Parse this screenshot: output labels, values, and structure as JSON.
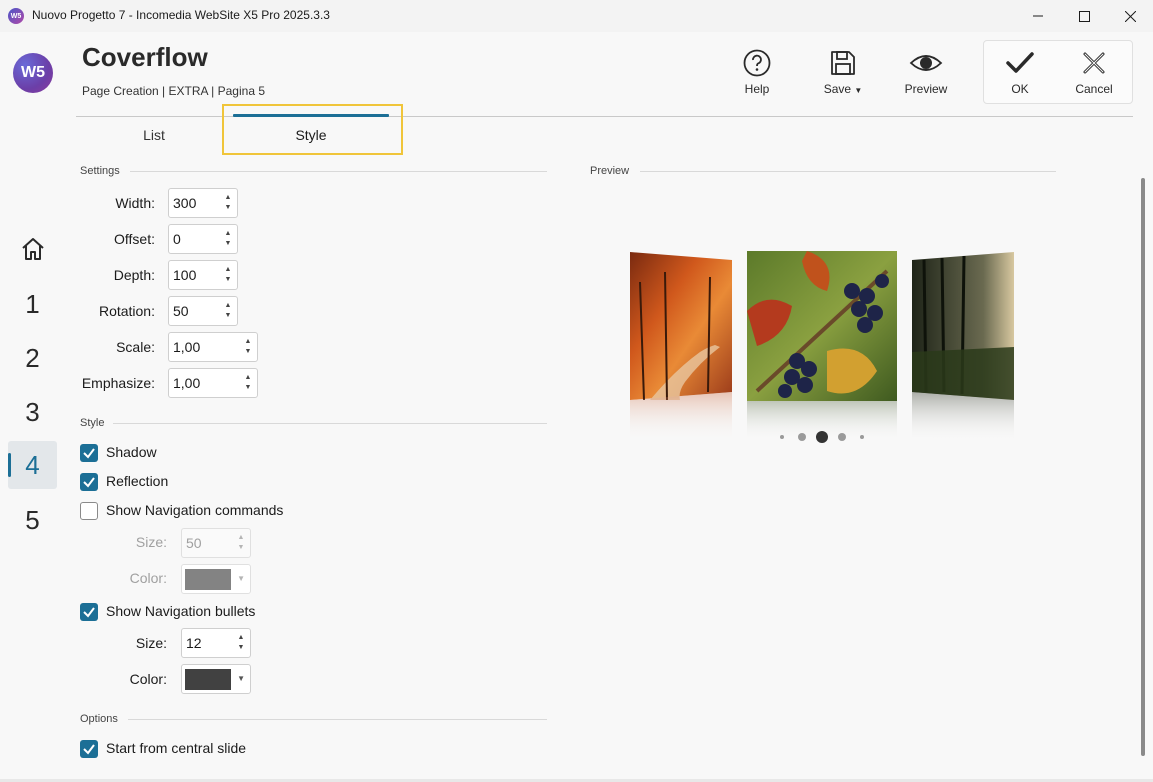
{
  "window": {
    "app_icon_text": "W5",
    "title": "Nuovo Progetto 7 - Incomedia WebSite X5 Pro 2025.3.3"
  },
  "nav": {
    "logo_text": "W5",
    "steps": [
      "1",
      "2",
      "3",
      "4",
      "5"
    ],
    "active_step": "4"
  },
  "header": {
    "title": "Coverflow",
    "breadcrumb": "Page Creation | EXTRA | Pagina 5"
  },
  "toolbar": {
    "help_label": "Help",
    "save_label": "Save",
    "preview_label": "Preview",
    "ok_label": "OK",
    "cancel_label": "Cancel"
  },
  "tabs": {
    "list_label": "List",
    "style_label": "Style",
    "active": "Style"
  },
  "settings": {
    "section_label": "Settings",
    "width_label": "Width:",
    "width_value": "300",
    "offset_label": "Offset:",
    "offset_value": "0",
    "depth_label": "Depth:",
    "depth_value": "100",
    "rotation_label": "Rotation:",
    "rotation_value": "50",
    "scale_label": "Scale:",
    "scale_value": "1,00",
    "emphasize_label": "Emphasize:",
    "emphasize_value": "1,00"
  },
  "style": {
    "section_label": "Style",
    "shadow_label": "Shadow",
    "shadow_checked": true,
    "reflection_label": "Reflection",
    "reflection_checked": true,
    "nav_commands_label": "Show Navigation commands",
    "nav_commands_checked": false,
    "nav_size_label": "Size:",
    "nav_size_value": "50",
    "nav_color_label": "Color:",
    "nav_color": "#838383",
    "nav_bullets_label": "Show Navigation bullets",
    "nav_bullets_checked": true,
    "bullets_size_label": "Size:",
    "bullets_size_value": "12",
    "bullets_color_label": "Color:",
    "bullets_color": "#414141"
  },
  "options": {
    "section_label": "Options",
    "central_slide_label": "Start from central slide",
    "central_slide_checked": true
  },
  "preview": {
    "section_label": "Preview",
    "slides": [
      "autumn-forest-path",
      "grapes-vine",
      "misty-forest"
    ],
    "bullet_count": 5,
    "active_bullet": 3
  },
  "colors": {
    "accent": "#1c6f96",
    "tab_highlight": "#f0c53a"
  }
}
